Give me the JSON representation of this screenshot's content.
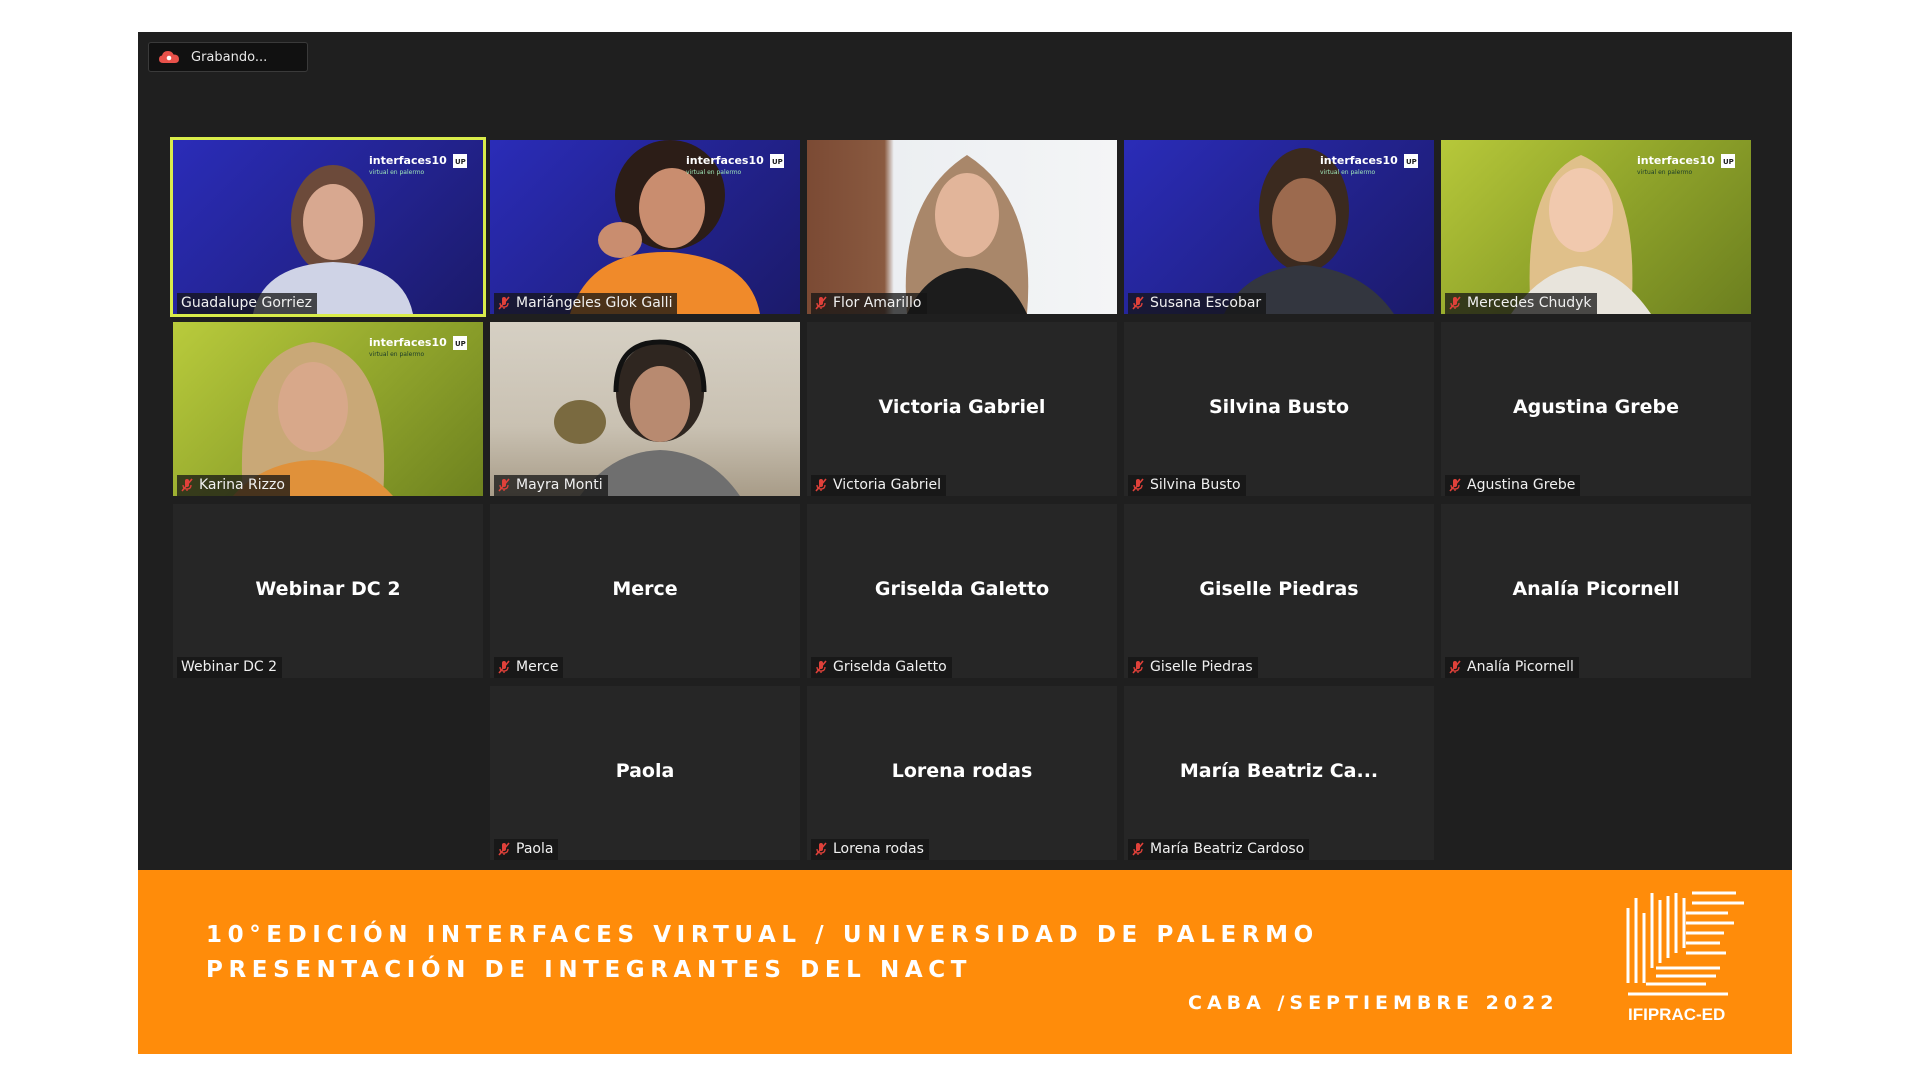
{
  "recording": {
    "label": "Grabando..."
  },
  "video_tiles": [
    {
      "name": "Guadalupe Gorriez",
      "muted": false,
      "active": true
    },
    {
      "name": "Mariángeles Glok Galli",
      "muted": true
    },
    {
      "name": "Flor Amarillo",
      "muted": true
    },
    {
      "name": "Susana Escobar",
      "muted": true
    },
    {
      "name": "Mercedes Chudyk",
      "muted": true
    },
    {
      "name": "Karina Rizzo",
      "muted": true
    },
    {
      "name": "Mayra Monti",
      "muted": true
    }
  ],
  "name_tiles": [
    {
      "display": "Victoria Gabriel",
      "label": "Victoria Gabriel",
      "muted": true
    },
    {
      "display": "Silvina Busto",
      "label": "Silvina Busto",
      "muted": true
    },
    {
      "display": "Agustina Grebe",
      "label": "Agustina Grebe",
      "muted": true
    },
    {
      "display": "Webinar DC 2",
      "label": "Webinar DC 2",
      "muted": false
    },
    {
      "display": "Merce",
      "label": "Merce",
      "muted": true
    },
    {
      "display": "Griselda Galetto",
      "label": "Griselda Galetto",
      "muted": true
    },
    {
      "display": "Giselle Piedras",
      "label": "Giselle Piedras",
      "muted": true
    },
    {
      "display": "Analía Picornell",
      "label": "Analía Picornell",
      "muted": true
    },
    {
      "display": "Paola",
      "label": "Paola",
      "muted": true
    },
    {
      "display": "Lorena rodas",
      "label": "Lorena rodas",
      "muted": true
    },
    {
      "display": "María Beatriz Ca...",
      "label": "María Beatriz Cardoso",
      "muted": true
    }
  ],
  "brand": {
    "name": "interfaces10",
    "sub": "virtual en palermo",
    "badge": "UP"
  },
  "banner": {
    "line1": "10°EDICIÓN INTERFACES VIRTUAL / UNIVERSIDAD DE PALERMO",
    "line2": "PRESENTACIÓN DE INTEGRANTES DEL NACT",
    "line3": "CABA /SEPTIEMBRE 2022",
    "logo_text": "IFIPRAC-ED"
  },
  "colors": {
    "meeting_bg": "#1f1f1f",
    "tile_bg": "#262626",
    "active_border": "#d9ec4a",
    "banner_bg": "#ff8c0a",
    "muted_mic": "#e0413a"
  }
}
